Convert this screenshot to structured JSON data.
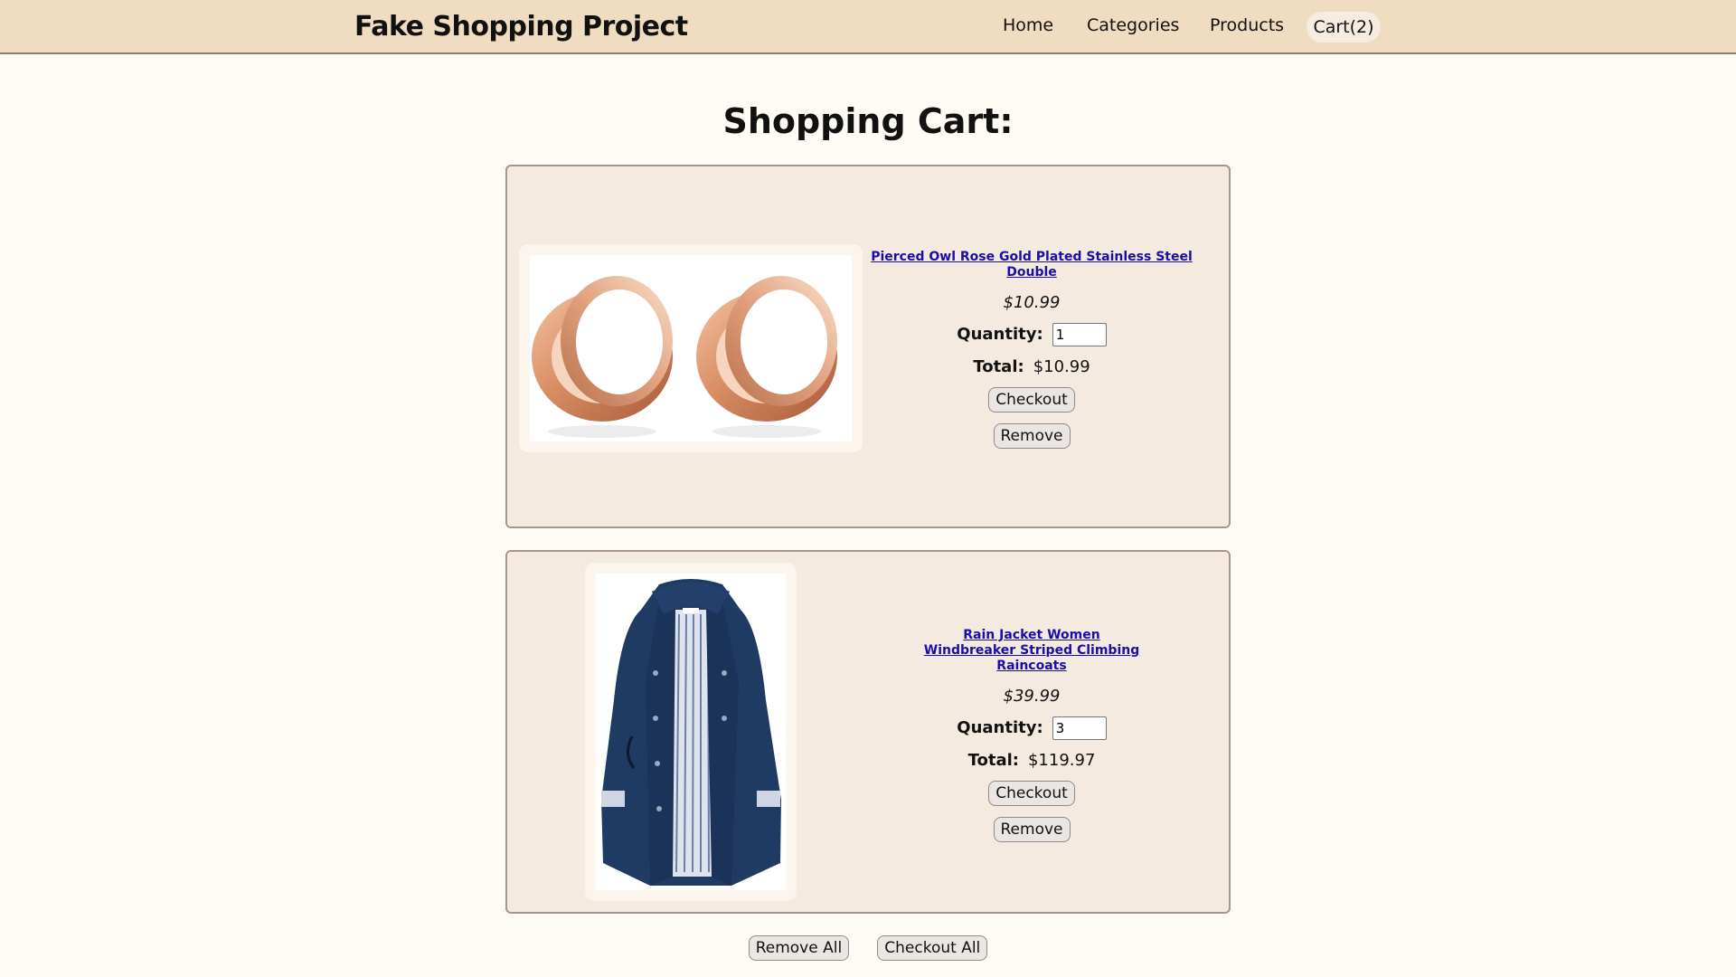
{
  "header": {
    "brand": "Fake Shopping Project",
    "nav": {
      "home": "Home",
      "categories": "Categories",
      "products": "Products",
      "cart": "Cart(2)"
    }
  },
  "page": {
    "title": "Shopping Cart:"
  },
  "cart": {
    "items": [
      {
        "name": "Pierced Owl Rose Gold Plated Stainless Steel Double",
        "price": "$10.99",
        "quantity_label": "Quantity:",
        "quantity": "1",
        "total_label": "Total:",
        "total": "$10.99",
        "checkout_label": "Checkout",
        "remove_label": "Remove"
      },
      {
        "name": "Rain Jacket Women Windbreaker Striped Climbing Raincoats",
        "price": "$39.99",
        "quantity_label": "Quantity:",
        "quantity": "3",
        "total_label": "Total:",
        "total": "$119.97",
        "checkout_label": "Checkout",
        "remove_label": "Remove"
      }
    ],
    "remove_all_label": "Remove All",
    "checkout_all_label": "Checkout All"
  },
  "colors": {
    "navbar_bg": "#f0dcc0",
    "page_bg": "#fffcf5",
    "card_bg": "#f5eadf",
    "link": "#1a0dab"
  }
}
